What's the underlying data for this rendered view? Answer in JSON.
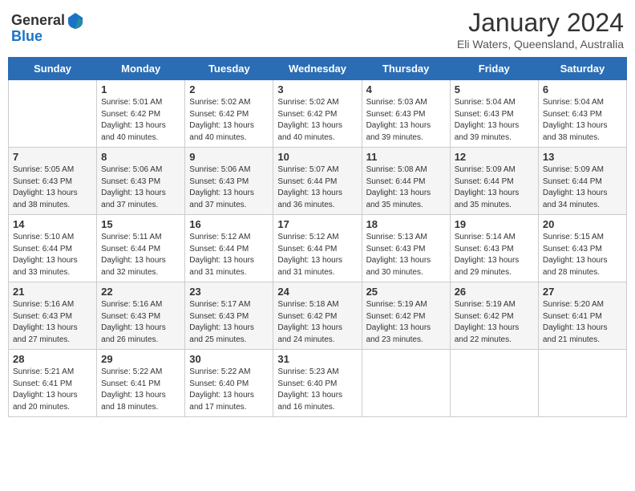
{
  "header": {
    "logo_general": "General",
    "logo_blue": "Blue",
    "title": "January 2024",
    "subtitle": "Eli Waters, Queensland, Australia"
  },
  "days_of_week": [
    "Sunday",
    "Monday",
    "Tuesday",
    "Wednesday",
    "Thursday",
    "Friday",
    "Saturday"
  ],
  "weeks": [
    [
      {
        "day": "",
        "info": ""
      },
      {
        "day": "1",
        "info": "Sunrise: 5:01 AM\nSunset: 6:42 PM\nDaylight: 13 hours\nand 40 minutes."
      },
      {
        "day": "2",
        "info": "Sunrise: 5:02 AM\nSunset: 6:42 PM\nDaylight: 13 hours\nand 40 minutes."
      },
      {
        "day": "3",
        "info": "Sunrise: 5:02 AM\nSunset: 6:42 PM\nDaylight: 13 hours\nand 40 minutes."
      },
      {
        "day": "4",
        "info": "Sunrise: 5:03 AM\nSunset: 6:43 PM\nDaylight: 13 hours\nand 39 minutes."
      },
      {
        "day": "5",
        "info": "Sunrise: 5:04 AM\nSunset: 6:43 PM\nDaylight: 13 hours\nand 39 minutes."
      },
      {
        "day": "6",
        "info": "Sunrise: 5:04 AM\nSunset: 6:43 PM\nDaylight: 13 hours\nand 38 minutes."
      }
    ],
    [
      {
        "day": "7",
        "info": "Sunrise: 5:05 AM\nSunset: 6:43 PM\nDaylight: 13 hours\nand 38 minutes."
      },
      {
        "day": "8",
        "info": "Sunrise: 5:06 AM\nSunset: 6:43 PM\nDaylight: 13 hours\nand 37 minutes."
      },
      {
        "day": "9",
        "info": "Sunrise: 5:06 AM\nSunset: 6:43 PM\nDaylight: 13 hours\nand 37 minutes."
      },
      {
        "day": "10",
        "info": "Sunrise: 5:07 AM\nSunset: 6:44 PM\nDaylight: 13 hours\nand 36 minutes."
      },
      {
        "day": "11",
        "info": "Sunrise: 5:08 AM\nSunset: 6:44 PM\nDaylight: 13 hours\nand 35 minutes."
      },
      {
        "day": "12",
        "info": "Sunrise: 5:09 AM\nSunset: 6:44 PM\nDaylight: 13 hours\nand 35 minutes."
      },
      {
        "day": "13",
        "info": "Sunrise: 5:09 AM\nSunset: 6:44 PM\nDaylight: 13 hours\nand 34 minutes."
      }
    ],
    [
      {
        "day": "14",
        "info": "Sunrise: 5:10 AM\nSunset: 6:44 PM\nDaylight: 13 hours\nand 33 minutes."
      },
      {
        "day": "15",
        "info": "Sunrise: 5:11 AM\nSunset: 6:44 PM\nDaylight: 13 hours\nand 32 minutes."
      },
      {
        "day": "16",
        "info": "Sunrise: 5:12 AM\nSunset: 6:44 PM\nDaylight: 13 hours\nand 31 minutes."
      },
      {
        "day": "17",
        "info": "Sunrise: 5:12 AM\nSunset: 6:44 PM\nDaylight: 13 hours\nand 31 minutes."
      },
      {
        "day": "18",
        "info": "Sunrise: 5:13 AM\nSunset: 6:43 PM\nDaylight: 13 hours\nand 30 minutes."
      },
      {
        "day": "19",
        "info": "Sunrise: 5:14 AM\nSunset: 6:43 PM\nDaylight: 13 hours\nand 29 minutes."
      },
      {
        "day": "20",
        "info": "Sunrise: 5:15 AM\nSunset: 6:43 PM\nDaylight: 13 hours\nand 28 minutes."
      }
    ],
    [
      {
        "day": "21",
        "info": "Sunrise: 5:16 AM\nSunset: 6:43 PM\nDaylight: 13 hours\nand 27 minutes."
      },
      {
        "day": "22",
        "info": "Sunrise: 5:16 AM\nSunset: 6:43 PM\nDaylight: 13 hours\nand 26 minutes."
      },
      {
        "day": "23",
        "info": "Sunrise: 5:17 AM\nSunset: 6:43 PM\nDaylight: 13 hours\nand 25 minutes."
      },
      {
        "day": "24",
        "info": "Sunrise: 5:18 AM\nSunset: 6:42 PM\nDaylight: 13 hours\nand 24 minutes."
      },
      {
        "day": "25",
        "info": "Sunrise: 5:19 AM\nSunset: 6:42 PM\nDaylight: 13 hours\nand 23 minutes."
      },
      {
        "day": "26",
        "info": "Sunrise: 5:19 AM\nSunset: 6:42 PM\nDaylight: 13 hours\nand 22 minutes."
      },
      {
        "day": "27",
        "info": "Sunrise: 5:20 AM\nSunset: 6:41 PM\nDaylight: 13 hours\nand 21 minutes."
      }
    ],
    [
      {
        "day": "28",
        "info": "Sunrise: 5:21 AM\nSunset: 6:41 PM\nDaylight: 13 hours\nand 20 minutes."
      },
      {
        "day": "29",
        "info": "Sunrise: 5:22 AM\nSunset: 6:41 PM\nDaylight: 13 hours\nand 18 minutes."
      },
      {
        "day": "30",
        "info": "Sunrise: 5:22 AM\nSunset: 6:40 PM\nDaylight: 13 hours\nand 17 minutes."
      },
      {
        "day": "31",
        "info": "Sunrise: 5:23 AM\nSunset: 6:40 PM\nDaylight: 13 hours\nand 16 minutes."
      },
      {
        "day": "",
        "info": ""
      },
      {
        "day": "",
        "info": ""
      },
      {
        "day": "",
        "info": ""
      }
    ]
  ]
}
